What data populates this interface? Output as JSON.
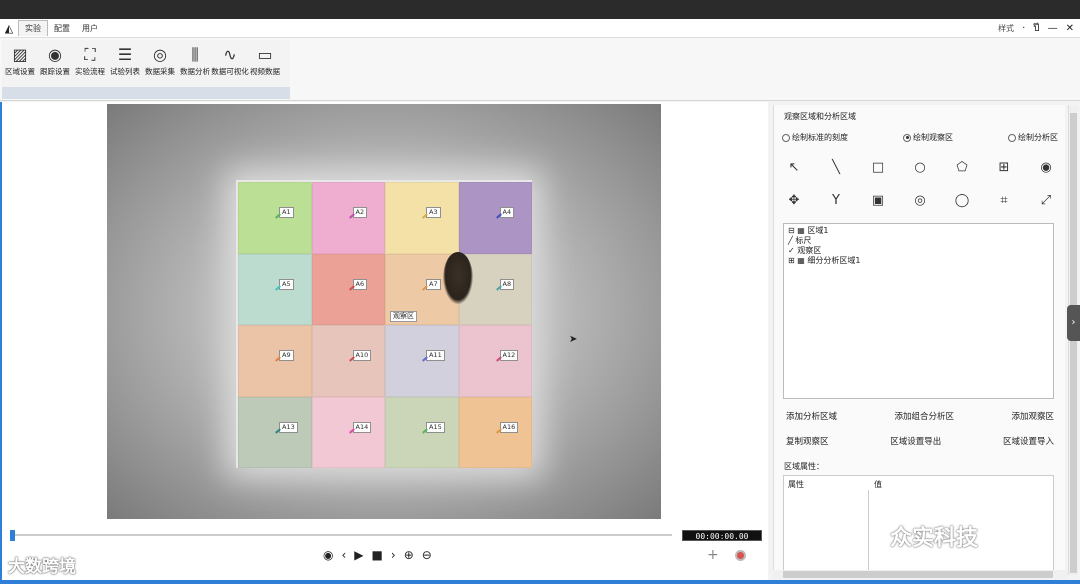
{
  "menu": {
    "tabs": [
      "实验",
      "配置",
      "用户"
    ],
    "active": 0
  },
  "window": {
    "style_label": "样式",
    "controls": [
      "·",
      "ปี",
      "—",
      "✕"
    ]
  },
  "ribbon": {
    "tools": [
      {
        "label": "区域设置",
        "icon": "hatch-icon",
        "glyph": "▨"
      },
      {
        "label": "跟踪设置",
        "icon": "tracking-icon",
        "glyph": "◉"
      },
      {
        "label": "实验流程",
        "icon": "flow-icon",
        "glyph": "⛶"
      },
      {
        "label": "试验列表",
        "icon": "list-icon",
        "glyph": "☰"
      },
      {
        "label": "数据采集",
        "icon": "camera-icon",
        "glyph": "◎"
      },
      {
        "label": "数据分析",
        "icon": "analysis-icon",
        "glyph": "⫼"
      },
      {
        "label": "数据可视化",
        "icon": "visual-icon",
        "glyph": "∿"
      },
      {
        "label": "视频数据",
        "icon": "video-icon",
        "glyph": "▭"
      }
    ]
  },
  "arena": {
    "zones": [
      {
        "label": "A1",
        "color": "#b8df8f"
      },
      {
        "label": "A2",
        "color": "#f0a8cf"
      },
      {
        "label": "A3",
        "color": "#f4e1a3"
      },
      {
        "label": "A4",
        "color": "#a78ec2"
      },
      {
        "label": "A5",
        "color": "#b9dccf"
      },
      {
        "label": "A6",
        "color": "#ec9c8f"
      },
      {
        "label": "A7",
        "color": "#eec7a0"
      },
      {
        "label": "A8",
        "color": "#d6d1bd"
      },
      {
        "label": "A9",
        "color": "#ecc1a2"
      },
      {
        "label": "A10",
        "color": "#e8c3b8"
      },
      {
        "label": "A11",
        "color": "#d1cfdb"
      },
      {
        "label": "A12",
        "color": "#ecc2cf"
      },
      {
        "label": "A13",
        "color": "#bac8b5"
      },
      {
        "label": "A14",
        "color": "#f2c6d3"
      },
      {
        "label": "A15",
        "color": "#c9d4b3"
      },
      {
        "label": "A16",
        "color": "#f1c08e"
      }
    ],
    "pin_colors": [
      "#4caf50",
      "#c03cb0",
      "#d2a93a",
      "#3a40c0",
      "#30c0c0",
      "#d04040",
      "#e08a3a",
      "#40a0a0",
      "#e07a3a",
      "#d04040",
      "#5a60d0",
      "#d04070",
      "#208080",
      "#e040a0",
      "#4caf50",
      "#e0902a"
    ],
    "observation_label": "观察区"
  },
  "player": {
    "time": "00:00:00.00",
    "controls": [
      "◉",
      "‹",
      "▶",
      "■",
      "›",
      "⊕",
      "⊖"
    ]
  },
  "panel": {
    "title": "观察区域和分析区域",
    "radios": [
      {
        "label": "绘制标准的刻度",
        "on": false
      },
      {
        "label": "绘制观察区",
        "on": true
      },
      {
        "label": "绘制分析区",
        "on": false
      }
    ],
    "tools_row1": [
      "↖",
      "╲",
      "□",
      "○",
      "⬠",
      "⊞",
      "◉"
    ],
    "tools_row2": [
      "✥",
      "Y",
      "▣",
      "◎",
      "◯",
      "⌗",
      "⤢"
    ],
    "tree": [
      "⊟ ▦ 区域1",
      "   ╱ 标尺",
      "   ✓ 观察区",
      " ⊞ ▦ 细分分析区域1"
    ],
    "buttons_row1": [
      "添加分析区域",
      "添加组合分析区",
      "添加观察区"
    ],
    "buttons_row2": [
      "复制观察区",
      "区域设置导出",
      "区域设置导入"
    ],
    "prop_title": "区域属性：",
    "prop_col1": "属性",
    "prop_col2": "值"
  },
  "watermarks": {
    "left": "大数跨境",
    "right": "众实科技"
  }
}
